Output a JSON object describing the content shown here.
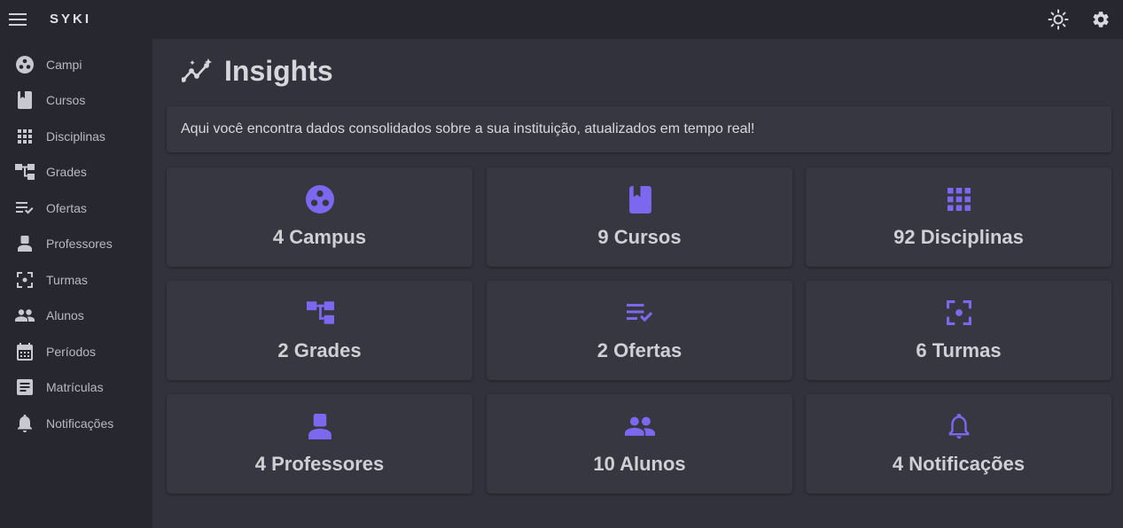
{
  "app": {
    "brand": "SYKI"
  },
  "sidebar": {
    "items": [
      {
        "label": "Campi",
        "icon": "campus-icon"
      },
      {
        "label": "Cursos",
        "icon": "book-icon"
      },
      {
        "label": "Disciplinas",
        "icon": "grid-icon"
      },
      {
        "label": "Grades",
        "icon": "tree-icon"
      },
      {
        "label": "Ofertas",
        "icon": "playlist-check-icon"
      },
      {
        "label": "Professores",
        "icon": "person-icon"
      },
      {
        "label": "Turmas",
        "icon": "center-focus-icon"
      },
      {
        "label": "Alunos",
        "icon": "people-icon"
      },
      {
        "label": "Períodos",
        "icon": "calendar-icon"
      },
      {
        "label": "Matrículas",
        "icon": "document-icon"
      },
      {
        "label": "Notificações",
        "icon": "bell-icon"
      }
    ]
  },
  "header": {
    "title": "Insights",
    "title_icon": "insights-icon"
  },
  "intro": {
    "text": "Aqui você encontra dados consolidados sobre a sua instituição, atualizados em tempo real!"
  },
  "cards": [
    {
      "label": "4 Campus",
      "icon": "campus-icon"
    },
    {
      "label": "9 Cursos",
      "icon": "book-icon"
    },
    {
      "label": "92 Disciplinas",
      "icon": "grid-icon"
    },
    {
      "label": "2 Grades",
      "icon": "tree-icon"
    },
    {
      "label": "2 Ofertas",
      "icon": "playlist-check-icon"
    },
    {
      "label": "6 Turmas",
      "icon": "center-focus-icon"
    },
    {
      "label": "4 Professores",
      "icon": "person-icon"
    },
    {
      "label": "10 Alunos",
      "icon": "people-icon"
    },
    {
      "label": "4 Notificações",
      "icon": "bell-icon"
    }
  ],
  "colors": {
    "accent": "#7b68ee",
    "background": "#32323d",
    "sidebar": "#27272f",
    "card": "#373742"
  }
}
